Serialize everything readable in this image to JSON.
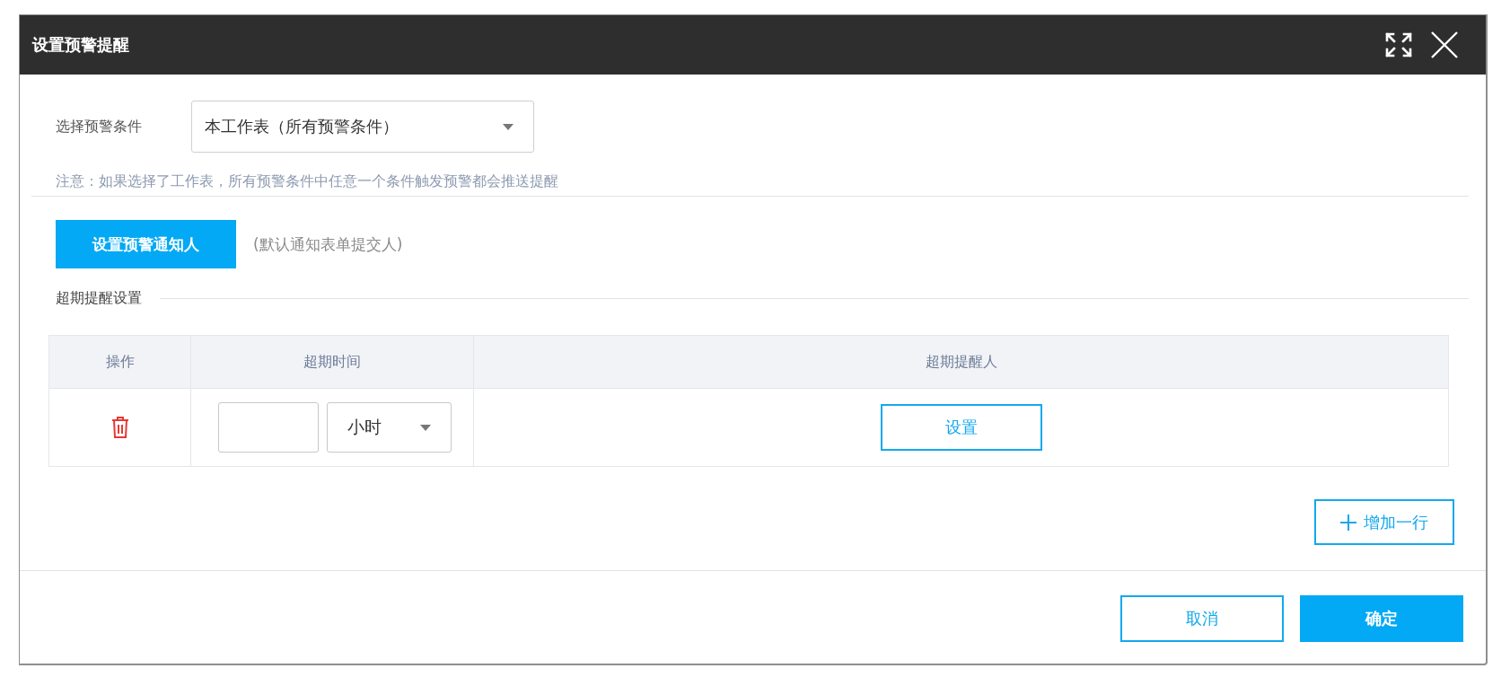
{
  "dialog": {
    "title": "设置预警提醒"
  },
  "condition": {
    "label": "选择预警条件",
    "value": "本工作表（所有预警条件）",
    "note": "注意：如果选择了工作表，所有预警条件中任意一个条件触发预警都会推送提醒"
  },
  "notify": {
    "button": "设置预警通知人",
    "hint": "(默认通知表单提交人)"
  },
  "overdue": {
    "title": "超期提醒设置",
    "columns": [
      "操作",
      "超期时间",
      "超期提醒人"
    ],
    "rows": [
      {
        "unit": "小时",
        "assign_button": "设置"
      }
    ],
    "add_button": "增加一行"
  },
  "footer": {
    "buttons": [
      {
        "label": "取消",
        "kind": "secondary"
      },
      {
        "label": "确定",
        "kind": "primary"
      }
    ]
  }
}
